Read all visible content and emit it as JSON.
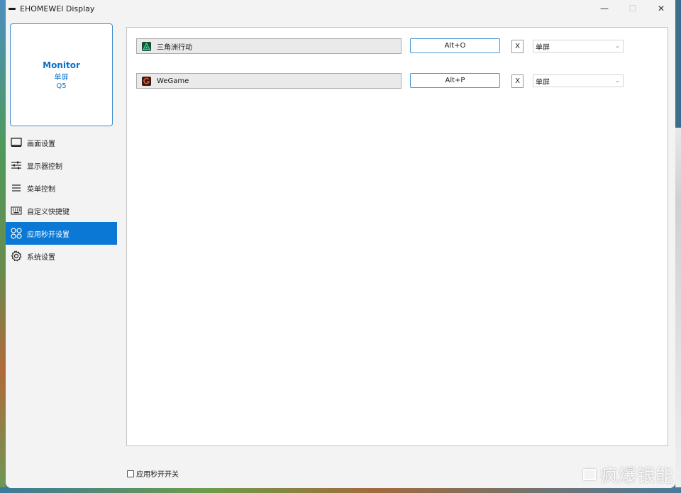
{
  "window": {
    "title": "EHOMEWEI Display",
    "minimize": "—",
    "maximize": "☐",
    "close": "✕"
  },
  "monitor": {
    "name": "Monitor",
    "mode": "单屏",
    "model": "Q5"
  },
  "sidebar": {
    "items": [
      {
        "label": "画面设置",
        "icon": "monitor-icon"
      },
      {
        "label": "显示器控制",
        "icon": "sliders-icon"
      },
      {
        "label": "菜单控制",
        "icon": "menu-icon"
      },
      {
        "label": "自定义快捷键",
        "icon": "keyboard-icon"
      },
      {
        "label": "应用秒开设置",
        "icon": "apps-grid-icon",
        "active": true
      },
      {
        "label": "系统设置",
        "icon": "gear-icon"
      }
    ]
  },
  "apps": [
    {
      "name": "三角洲行动",
      "hotkey": "Alt+O",
      "remove": "X",
      "mode": "单屏",
      "logo": "delta-force-logo"
    },
    {
      "name": "WeGame",
      "hotkey": "Alt+P",
      "remove": "X",
      "mode": "单屏",
      "logo": "wegame-logo"
    }
  ],
  "footer": {
    "toggle_label": "应用秒开开关",
    "checked": false
  },
  "watermark": {
    "text": "疯爆银能"
  },
  "colors": {
    "accent": "#0a78d4",
    "monitor_text": "#0a72c9",
    "hotkey_border": "#4a96d6"
  }
}
